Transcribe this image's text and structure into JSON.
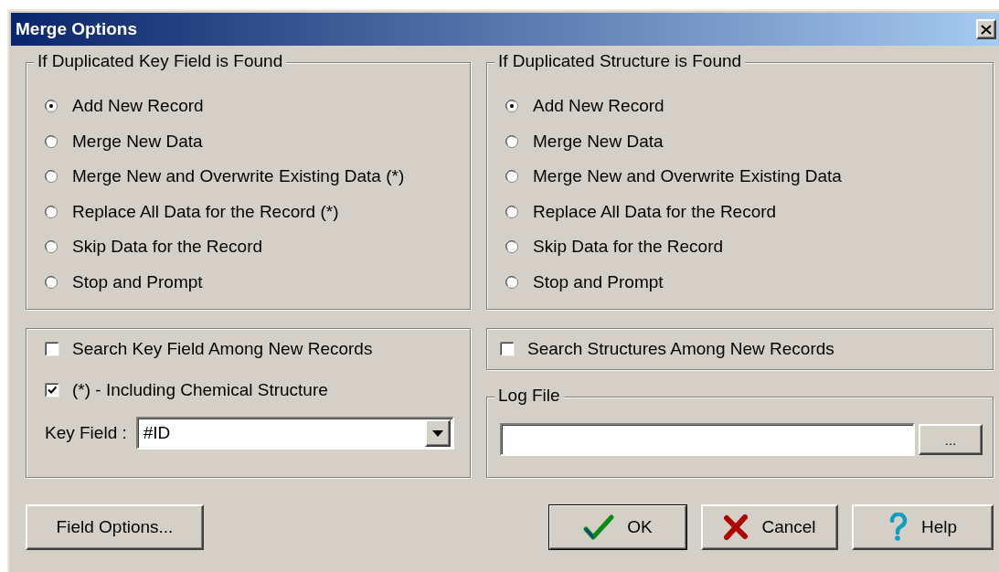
{
  "window": {
    "title": "Merge Options"
  },
  "key_field_group": {
    "title": "If Duplicated Key Field is Found",
    "options": [
      {
        "label": "Add New Record",
        "selected": true
      },
      {
        "label": "Merge New Data",
        "selected": false
      },
      {
        "label": "Merge New and Overwrite Existing Data (*)",
        "selected": false
      },
      {
        "label": "Replace All Data for the Record (*)",
        "selected": false
      },
      {
        "label": "Skip Data for the Record",
        "selected": false
      },
      {
        "label": "Stop and Prompt",
        "selected": false
      }
    ]
  },
  "structure_group": {
    "title": "If Duplicated Structure is Found",
    "options": [
      {
        "label": "Add New Record",
        "selected": true
      },
      {
        "label": "Merge New Data",
        "selected": false
      },
      {
        "label": "Merge New and Overwrite Existing Data",
        "selected": false
      },
      {
        "label": "Replace All Data for the Record",
        "selected": false
      },
      {
        "label": "Skip Data for the Record",
        "selected": false
      },
      {
        "label": "Stop and Prompt",
        "selected": false
      }
    ]
  },
  "key_options": {
    "checkboxes": [
      {
        "label": "Search Key Field Among New Records",
        "checked": false
      },
      {
        "label": "(*) - Including Chemical Structure",
        "checked": true
      }
    ],
    "key_field": {
      "label": "Key Field :",
      "value": "#ID"
    }
  },
  "structure_search": {
    "label": "Search Structures Among New Records",
    "checked": false
  },
  "log_file": {
    "title": "Log File",
    "browse_button": "..."
  },
  "buttons": [
    {
      "label": "Field Options...",
      "kind": "plain"
    },
    {
      "label": "OK",
      "kind": "ok"
    },
    {
      "label": "Cancel",
      "kind": "cancel"
    },
    {
      "label": "Help",
      "kind": "help"
    }
  ]
}
